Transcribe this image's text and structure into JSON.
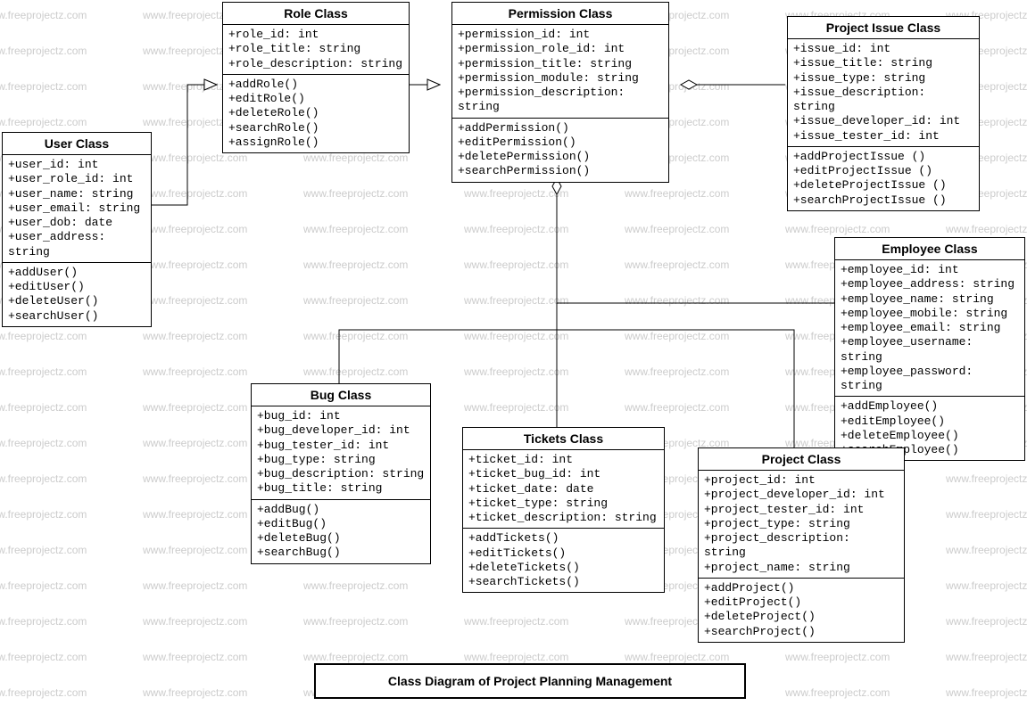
{
  "diagram_title": "Class Diagram of Project Planning Management",
  "watermark_text": "www.freeprojectz.com",
  "classes": {
    "user": {
      "name": "User Class",
      "attrs": [
        "+user_id: int",
        "+user_role_id: int",
        "+user_name: string",
        "+user_email: string",
        "+user_dob: date",
        "+user_address: string"
      ],
      "methods": [
        "+addUser()",
        "+editUser()",
        "+deleteUser()",
        "+searchUser()"
      ]
    },
    "role": {
      "name": "Role Class",
      "attrs": [
        "+role_id: int",
        "+role_title: string",
        "+role_description: string"
      ],
      "methods": [
        "+addRole()",
        "+editRole()",
        "+deleteRole()",
        "+searchRole()",
        "+assignRole()"
      ]
    },
    "permission": {
      "name": "Permission Class",
      "attrs": [
        "+permission_id: int",
        "+permission_role_id: int",
        "+permission_title: string",
        "+permission_module: string",
        "+permission_description: string"
      ],
      "methods": [
        "+addPermission()",
        "+editPermission()",
        "+deletePermission()",
        "+searchPermission()"
      ]
    },
    "project_issue": {
      "name": "Project Issue Class",
      "attrs": [
        "+issue_id: int",
        "+issue_title: string",
        "+issue_type: string",
        "+issue_description: string",
        "+issue_developer_id: int",
        "+issue_tester_id: int"
      ],
      "methods": [
        "+addProjectIssue ()",
        "+editProjectIssue ()",
        "+deleteProjectIssue ()",
        "+searchProjectIssue ()"
      ]
    },
    "employee": {
      "name": "Employee Class",
      "attrs": [
        "+employee_id: int",
        "+employee_address: string",
        "+employee_name: string",
        "+employee_mobile: string",
        "+employee_email: string",
        "+employee_username: string",
        "+employee_password: string"
      ],
      "methods": [
        "+addEmployee()",
        "+editEmployee()",
        "+deleteEmployee()",
        "+searchEmployee()"
      ]
    },
    "bug": {
      "name": "Bug Class",
      "attrs": [
        "+bug_id: int",
        "+bug_developer_id: int",
        "+bug_tester_id: int",
        "+bug_type: string",
        "+bug_description: string",
        "+bug_title: string"
      ],
      "methods": [
        "+addBug()",
        "+editBug()",
        "+deleteBug()",
        "+searchBug()"
      ]
    },
    "tickets": {
      "name": "Tickets Class",
      "attrs": [
        "+ticket_id: int",
        "+ticket_bug_id: int",
        "+ticket_date: date",
        "+ticket_type: string",
        "+ticket_description: string"
      ],
      "methods": [
        "+addTickets()",
        "+editTickets()",
        "+deleteTickets()",
        "+searchTickets()"
      ]
    },
    "project": {
      "name": "Project Class",
      "attrs": [
        "+project_id: int",
        "+project_developer_id: int",
        "+project_tester_id: int",
        "+project_type: string",
        "+project_description: string",
        "+project_name: string"
      ],
      "methods": [
        "+addProject()",
        "+editProject()",
        "+deleteProject()",
        "+searchProject()"
      ]
    }
  }
}
